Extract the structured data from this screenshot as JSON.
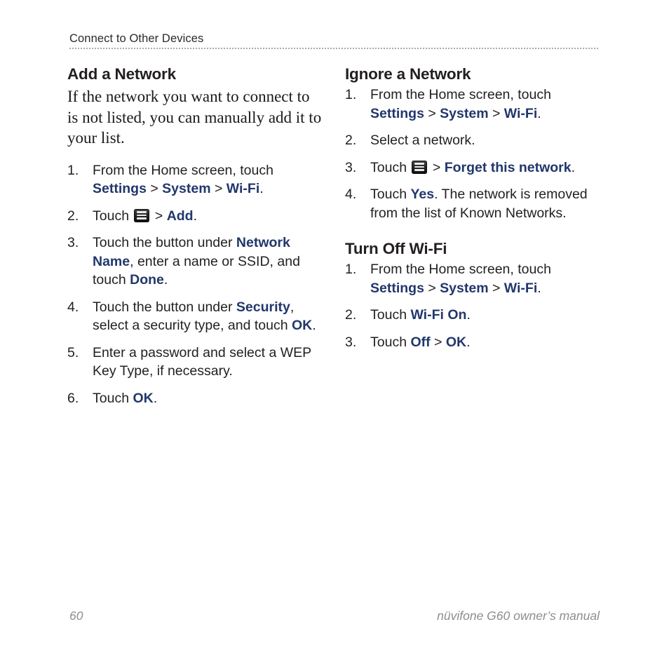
{
  "header": {
    "running_title": "Connect to Other Devices"
  },
  "colors": {
    "accent_blue": "#22376b",
    "heading": "#231f20",
    "footer_gray": "#8d8d8d"
  },
  "left_column": {
    "section_title": "Add a Network",
    "intro": "If the network you want to connect to is not listed, you can manually add it to your list.",
    "steps": [
      {
        "num": "1.",
        "parts": [
          {
            "t": "From the Home screen, touch ",
            "s": "plain"
          },
          {
            "t": "Settings",
            "s": "bold-blue"
          },
          {
            "t": " > ",
            "s": "plain"
          },
          {
            "t": "System",
            "s": "bold-blue"
          },
          {
            "t": " > ",
            "s": "plain"
          },
          {
            "t": "Wi-Fi",
            "s": "bold-blue"
          },
          {
            "t": ".",
            "s": "plain"
          }
        ]
      },
      {
        "num": "2.",
        "parts": [
          {
            "t": "Touch ",
            "s": "plain"
          },
          {
            "t": "menu-icon",
            "s": "icon"
          },
          {
            "t": " > ",
            "s": "plain"
          },
          {
            "t": "Add",
            "s": "bold-blue"
          },
          {
            "t": ".",
            "s": "plain"
          }
        ]
      },
      {
        "num": "3.",
        "parts": [
          {
            "t": "Touch the button under ",
            "s": "plain"
          },
          {
            "t": "Network Name",
            "s": "bold-blue"
          },
          {
            "t": ", enter a name or SSID, and touch ",
            "s": "plain"
          },
          {
            "t": "Done",
            "s": "bold-blue"
          },
          {
            "t": ".",
            "s": "plain"
          }
        ]
      },
      {
        "num": "4.",
        "parts": [
          {
            "t": "Touch the button under ",
            "s": "plain"
          },
          {
            "t": "Security",
            "s": "bold-blue"
          },
          {
            "t": ", select a security type, and touch ",
            "s": "plain"
          },
          {
            "t": "OK",
            "s": "bold-blue"
          },
          {
            "t": ".",
            "s": "plain"
          }
        ]
      },
      {
        "num": "5.",
        "parts": [
          {
            "t": "Enter a password and select a WEP Key Type, if necessary.",
            "s": "plain"
          }
        ]
      },
      {
        "num": "6.",
        "parts": [
          {
            "t": "Touch ",
            "s": "plain"
          },
          {
            "t": "OK",
            "s": "bold-blue"
          },
          {
            "t": ".",
            "s": "plain"
          }
        ]
      }
    ]
  },
  "right_column": {
    "sections": [
      {
        "title": "Ignore a Network",
        "steps": [
          {
            "num": "1.",
            "parts": [
              {
                "t": "From the Home screen, touch ",
                "s": "plain"
              },
              {
                "t": "Settings",
                "s": "bold-blue"
              },
              {
                "t": " > ",
                "s": "plain"
              },
              {
                "t": "System",
                "s": "bold-blue"
              },
              {
                "t": " > ",
                "s": "plain"
              },
              {
                "t": "Wi-Fi",
                "s": "bold-blue"
              },
              {
                "t": ".",
                "s": "plain"
              }
            ]
          },
          {
            "num": "2.",
            "parts": [
              {
                "t": "Select a network.",
                "s": "plain"
              }
            ]
          },
          {
            "num": "3.",
            "parts": [
              {
                "t": "Touch ",
                "s": "plain"
              },
              {
                "t": "menu-icon",
                "s": "icon"
              },
              {
                "t": " > ",
                "s": "plain"
              },
              {
                "t": "Forget this network",
                "s": "bold-blue"
              },
              {
                "t": ".",
                "s": "plain"
              }
            ]
          },
          {
            "num": "4.",
            "parts": [
              {
                "t": "Touch ",
                "s": "plain"
              },
              {
                "t": "Yes",
                "s": "bold-blue"
              },
              {
                "t": ". The network is removed from the list of Known Networks.",
                "s": "plain"
              }
            ]
          }
        ]
      },
      {
        "title": "Turn Off Wi-Fi",
        "steps": [
          {
            "num": "1.",
            "parts": [
              {
                "t": "From the Home screen, touch ",
                "s": "plain"
              },
              {
                "t": "Settings",
                "s": "bold-blue"
              },
              {
                "t": " > ",
                "s": "plain"
              },
              {
                "t": "System",
                "s": "bold-blue"
              },
              {
                "t": " > ",
                "s": "plain"
              },
              {
                "t": "Wi-Fi",
                "s": "bold-blue"
              },
              {
                "t": ".",
                "s": "plain"
              }
            ]
          },
          {
            "num": "2.",
            "parts": [
              {
                "t": "Touch ",
                "s": "plain"
              },
              {
                "t": "Wi-Fi On",
                "s": "bold-blue"
              },
              {
                "t": ".",
                "s": "plain"
              }
            ]
          },
          {
            "num": "3.",
            "parts": [
              {
                "t": "Touch ",
                "s": "plain"
              },
              {
                "t": "Off",
                "s": "bold-blue"
              },
              {
                "t": " > ",
                "s": "plain"
              },
              {
                "t": "OK",
                "s": "bold-blue"
              },
              {
                "t": ".",
                "s": "plain"
              }
            ]
          }
        ]
      }
    ]
  },
  "footer": {
    "page_number": "60",
    "manual_name": "nüvifone G60 owner’s manual"
  }
}
